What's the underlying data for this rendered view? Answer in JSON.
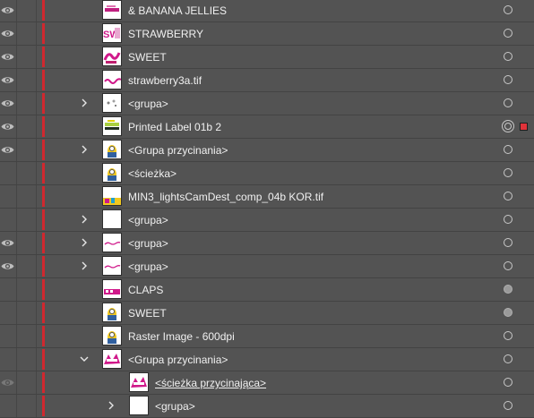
{
  "colors": {
    "panel_bg": "#535353",
    "layer_color": "#d0282f",
    "selection_square": "#e0333a"
  },
  "layers": [
    {
      "name": "& BANANA JELLIES",
      "visible": true,
      "indent": 0,
      "expandable": false,
      "expanded": false,
      "underline": false,
      "target": "hollow",
      "selected": false,
      "thumb": "jellies"
    },
    {
      "name": "STRAWBERRY",
      "visible": true,
      "indent": 0,
      "expandable": false,
      "expanded": false,
      "underline": false,
      "target": "hollow",
      "selected": false,
      "thumb": "text-magenta"
    },
    {
      "name": "SWEET",
      "visible": true,
      "indent": 0,
      "expandable": false,
      "expanded": false,
      "underline": false,
      "target": "hollow",
      "selected": false,
      "thumb": "sweet"
    },
    {
      "name": "strawberry3a.tif",
      "visible": true,
      "indent": 0,
      "expandable": false,
      "expanded": false,
      "underline": false,
      "target": "hollow",
      "selected": false,
      "thumb": "wave"
    },
    {
      "name": "<grupa>",
      "visible": true,
      "indent": 0,
      "expandable": true,
      "expanded": false,
      "underline": false,
      "target": "hollow",
      "selected": false,
      "thumb": "dots"
    },
    {
      "name": "Printed Label 01b 2",
      "visible": true,
      "indent": 0,
      "expandable": false,
      "expanded": false,
      "underline": false,
      "target": "ring",
      "selected": true,
      "thumb": "label"
    },
    {
      "name": "<Grupa przycinania>",
      "visible": true,
      "indent": 0,
      "expandable": true,
      "expanded": false,
      "underline": false,
      "target": "hollow",
      "selected": false,
      "thumb": "minion"
    },
    {
      "name": "<ścieżka>",
      "visible": false,
      "indent": 0,
      "expandable": false,
      "expanded": false,
      "underline": false,
      "target": "hollow",
      "selected": false,
      "thumb": "minion"
    },
    {
      "name": "MIN3_lightsCamDest_comp_04b KOR.tif",
      "visible": false,
      "indent": 0,
      "expandable": false,
      "expanded": false,
      "underline": false,
      "target": "hollow",
      "selected": false,
      "thumb": "colorful"
    },
    {
      "name": "<grupa>",
      "visible": false,
      "indent": 0,
      "expandable": true,
      "expanded": false,
      "underline": false,
      "target": "hollow",
      "selected": false,
      "thumb": "blank"
    },
    {
      "name": "<grupa>",
      "visible": true,
      "indent": 0,
      "expandable": true,
      "expanded": false,
      "underline": false,
      "target": "hollow",
      "selected": false,
      "thumb": "squiggle"
    },
    {
      "name": "<grupa>",
      "visible": true,
      "indent": 0,
      "expandable": true,
      "expanded": false,
      "underline": false,
      "target": "hollow",
      "selected": false,
      "thumb": "squiggle"
    },
    {
      "name": "CLAPS",
      "visible": false,
      "indent": 0,
      "expandable": false,
      "expanded": false,
      "underline": false,
      "target": "filled",
      "selected": false,
      "thumb": "claps"
    },
    {
      "name": "SWEET",
      "visible": false,
      "indent": 0,
      "expandable": false,
      "expanded": false,
      "underline": false,
      "target": "filled",
      "selected": false,
      "thumb": "minion"
    },
    {
      "name": "Raster Image - 600dpi",
      "visible": false,
      "indent": 0,
      "expandable": false,
      "expanded": false,
      "underline": false,
      "target": "hollow",
      "selected": false,
      "thumb": "minion"
    },
    {
      "name": "<Grupa przycinania>",
      "visible": false,
      "indent": 0,
      "expandable": true,
      "expanded": true,
      "underline": false,
      "target": "hollow",
      "selected": false,
      "thumb": "pink-splash"
    },
    {
      "name": "<ścieżka przycinająca>",
      "visible": "dim",
      "indent": 1,
      "expandable": false,
      "expanded": false,
      "underline": true,
      "target": "hollow",
      "selected": false,
      "thumb": "pink-splash"
    },
    {
      "name": "<grupa>",
      "visible": false,
      "indent": 1,
      "expandable": true,
      "expanded": false,
      "underline": false,
      "target": "hollow",
      "selected": false,
      "thumb": "blank"
    }
  ]
}
